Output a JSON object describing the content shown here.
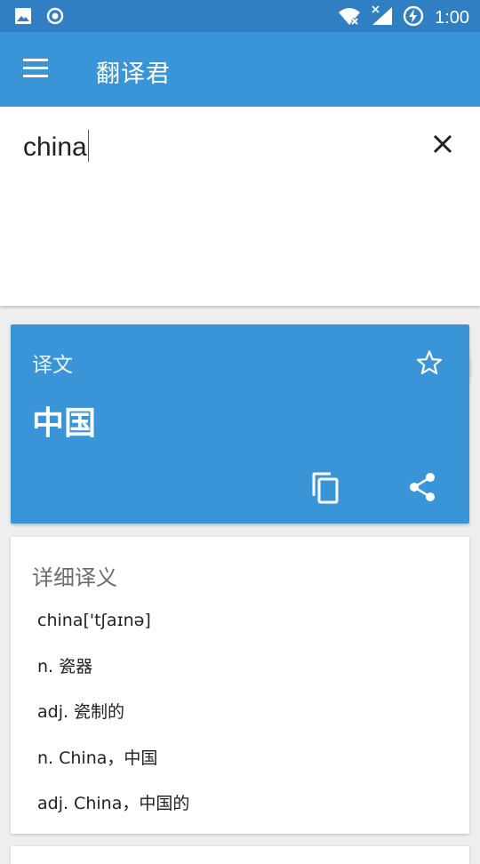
{
  "status_bar": {
    "time": "1:00",
    "icons": [
      "image-icon",
      "record-icon",
      "wifi-icon",
      "signal-icon",
      "battery-charging-icon"
    ]
  },
  "app_bar": {
    "title": "翻译君",
    "menu_icon": "menu-icon"
  },
  "input": {
    "value": "china",
    "clear_icon": "close-icon",
    "submit_icon": "arrow-right-icon"
  },
  "result": {
    "label": "译文",
    "text": "中国",
    "favorite_icon": "star-outline-icon",
    "copy_icon": "copy-icon",
    "share_icon": "share-icon"
  },
  "details": {
    "title": "详细译义",
    "items": [
      "china['tʃaɪnə]",
      "n. 瓷器",
      "adj. 瓷制的",
      "n. China，中国",
      "adj. China，中国的"
    ]
  },
  "colors": {
    "status_bar": "#2f7fc2",
    "app_bar": "#3a95d8",
    "fab": "#2ea8f0",
    "background": "#eeeeee"
  }
}
